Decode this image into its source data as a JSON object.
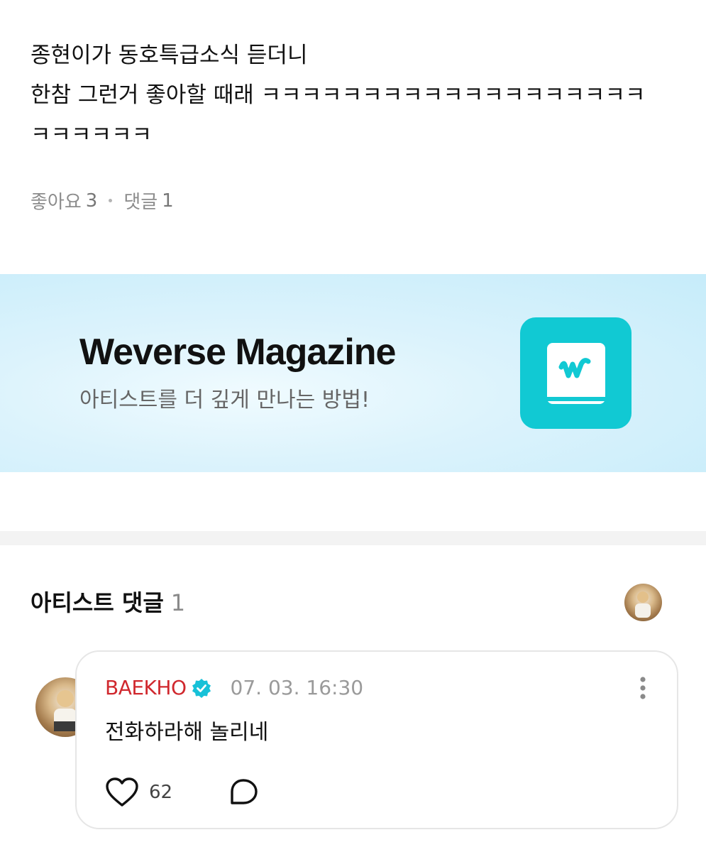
{
  "post": {
    "lines": [
      "종현이가 동호특급소식 듣더니",
      "한참 그런거 좋아할 때래 ㅋㅋㅋㅋㅋㅋㅋㅋㅋㅋㅋㅋㅋㅋㅋㅋㅋㅋㅋ",
      "ㅋㅋㅋㅋㅋㅋ"
    ],
    "likes_label": "좋아요",
    "likes_count": "3",
    "comments_label": "댓글",
    "comments_count": "1"
  },
  "banner": {
    "title": "Weverse Magazine",
    "subtitle": "아티스트를 더 깊게 만나는 방법!",
    "icon": "weverse-magazine-book-icon",
    "accent": "#11c9d3"
  },
  "artist_comments": {
    "title": "아티스트 댓글",
    "count": "1",
    "comment": {
      "author": "BAEKHO",
      "timestamp": "07. 03. 16:30",
      "text": "전화하라해 놀리네",
      "like_count": "62",
      "author_color": "#d0282e"
    }
  }
}
